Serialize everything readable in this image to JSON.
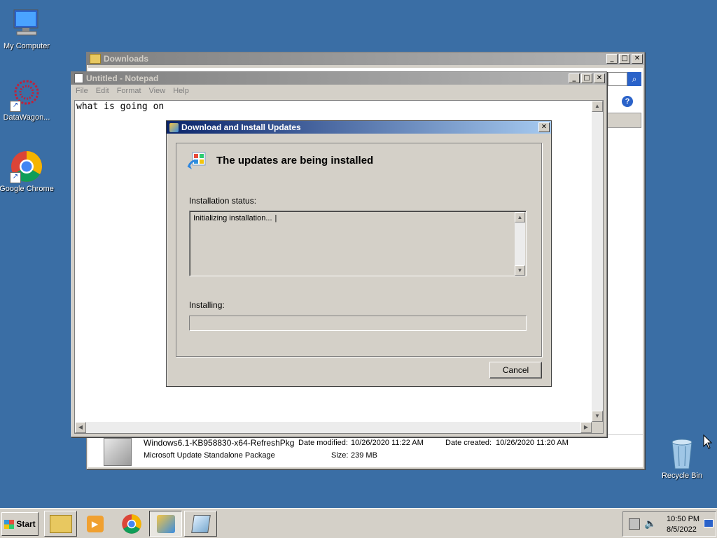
{
  "desktop": {
    "icons": [
      {
        "label": "My Computer"
      },
      {
        "label": "DataWagon..."
      },
      {
        "label": "Google Chrome"
      },
      {
        "label": "Recycle Bin"
      }
    ]
  },
  "downloads_window": {
    "title": "Downloads",
    "details": {
      "file_name": "Windows6.1-KB958830-x64-RefreshPkg",
      "file_type": "Microsoft Update Standalone Package",
      "date_modified_label": "Date modified:",
      "date_modified": "10/26/2020 11:22 AM",
      "date_created_label": "Date created:",
      "date_created": "10/26/2020 11:20 AM",
      "size_label": "Size:",
      "size": "239 MB"
    }
  },
  "notepad": {
    "title": "Untitled - Notepad",
    "menu": [
      "File",
      "Edit",
      "Format",
      "View",
      "Help"
    ],
    "text": "what is going on"
  },
  "update_dialog": {
    "title": "Download and Install Updates",
    "heading": "The updates are being installed",
    "status_label": "Installation status:",
    "status_text": "Initializing installation...",
    "installing_label": "Installing:",
    "progress": 0,
    "cancel_label": "Cancel"
  },
  "taskbar": {
    "start_label": "Start",
    "time": "10:50 PM",
    "date": "8/5/2022"
  },
  "colors": {
    "desktop": "#3a6ea5",
    "active_title": "#0a246a",
    "face": "#d4d0c8"
  }
}
